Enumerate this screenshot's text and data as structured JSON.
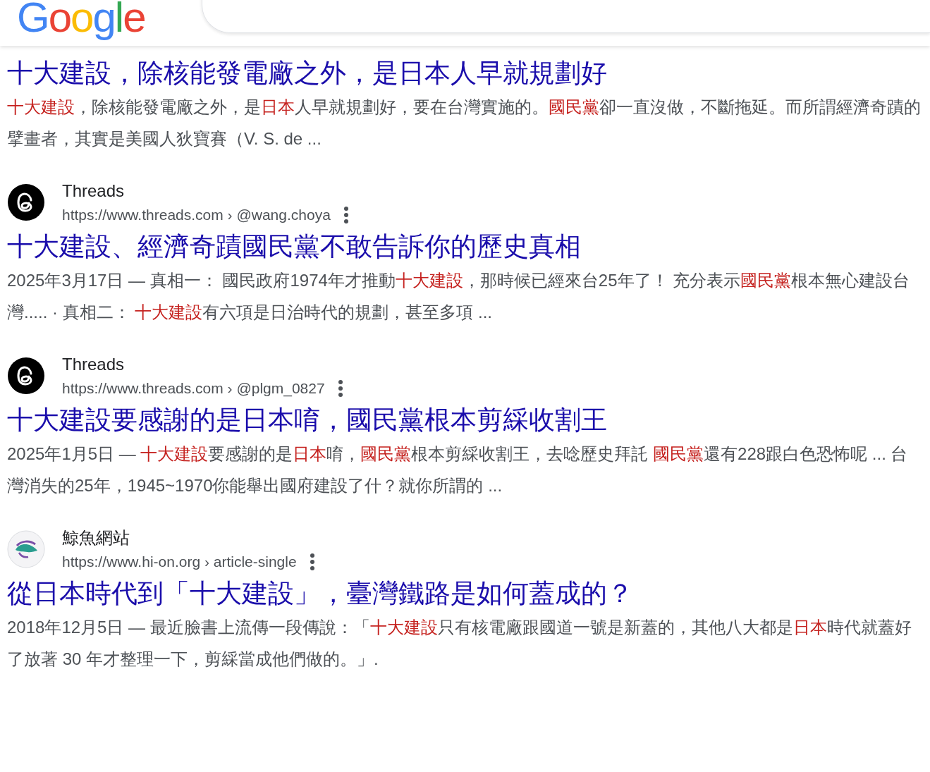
{
  "header": {
    "logo": "Google"
  },
  "results": [
    {
      "title": "十大建設，除核能發電廠之外，是日本人早就規劃好",
      "snippet": [
        {
          "text": "十大建設",
          "highlighted": true
        },
        {
          "text": "，除核能發電廠之外，是",
          "highlighted": false
        },
        {
          "text": "日本",
          "highlighted": true
        },
        {
          "text": "人早就規劃好，要在台灣實施的。",
          "highlighted": false
        },
        {
          "text": "國民黨",
          "highlighted": true
        },
        {
          "text": "卻一直沒做，不斷拖延。而所謂經濟奇蹟的擘畫者，其實是美國人狄寶賽（V. S. de ...",
          "highlighted": false
        }
      ]
    },
    {
      "source": {
        "kind": "dark",
        "name": "Threads",
        "url": "https://www.threads.com › @wang.choya"
      },
      "title": "十大建設、經濟奇蹟國民黨不敢告訴你的歷史真相",
      "date": "2025年3月17日 — ",
      "snippet": [
        {
          "text": "真相一： 國民政府1974年才推動",
          "highlighted": false
        },
        {
          "text": "十大建設",
          "highlighted": true
        },
        {
          "text": "，那時候已經來台25年了！ 充分表示",
          "highlighted": false
        },
        {
          "text": "國民黨",
          "highlighted": true
        },
        {
          "text": "根本無心建設台灣..... · 真相二： ",
          "highlighted": false
        },
        {
          "text": "十大建設",
          "highlighted": true
        },
        {
          "text": "有六項是日治時代的規劃，甚至多項 ...",
          "highlighted": false
        }
      ]
    },
    {
      "source": {
        "kind": "dark",
        "name": "Threads",
        "url": "https://www.threads.com › @plgm_0827"
      },
      "title": "十大建設要感謝的是日本唷，國民黨根本剪綵收割王",
      "date": "2025年1月5日 — ",
      "snippet": [
        {
          "text": "十大建設",
          "highlighted": true
        },
        {
          "text": "要感謝的是",
          "highlighted": false
        },
        {
          "text": "日本",
          "highlighted": true
        },
        {
          "text": "唷，",
          "highlighted": false
        },
        {
          "text": "國民黨",
          "highlighted": true
        },
        {
          "text": "根本剪綵收割王，去唸歷史拜託 ",
          "highlighted": false
        },
        {
          "text": "國民黨",
          "highlighted": true
        },
        {
          "text": "還有228跟白色恐怖呢 ... 台灣消失的25年，1945~1970你能舉出國府建設了什？就你所謂的 ...",
          "highlighted": false
        }
      ]
    },
    {
      "source": {
        "kind": "light",
        "name": "鯨魚網站",
        "url": "https://www.hi-on.org › article-single"
      },
      "title": "從日本時代到「十大建設」，臺灣鐵路是如何蓋成的？",
      "date": "2018年12月5日 — ",
      "snippet": [
        {
          "text": "最近臉書上流傳一段傳說：「",
          "highlighted": false
        },
        {
          "text": "十大建設",
          "highlighted": true
        },
        {
          "text": "只有核電廠跟國道一號是新蓋的，其他八大都是",
          "highlighted": false
        },
        {
          "text": "日本",
          "highlighted": true
        },
        {
          "text": "時代就蓋好了放著 30 年才整理一下，剪綵當成他們做的。」.",
          "highlighted": false
        }
      ]
    }
  ]
}
